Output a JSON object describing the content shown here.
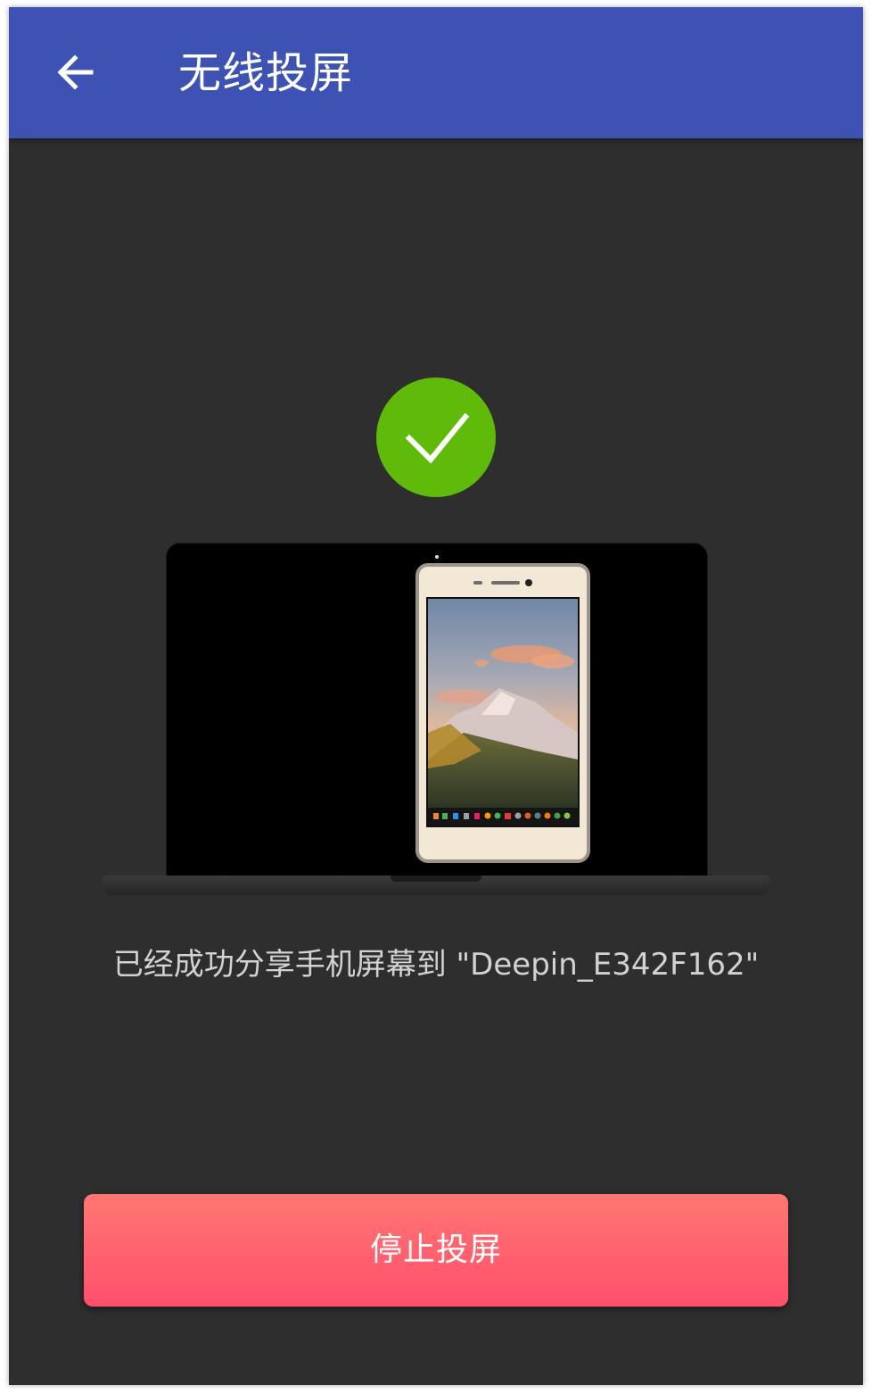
{
  "header": {
    "title": "无线投屏",
    "back_icon": "arrow-left-icon",
    "background_color": "#3e52b4"
  },
  "status": {
    "icon": "checkmark-icon",
    "icon_color": "#5fba0a",
    "message": "已经成功分享手机屏幕到 \"Deepin_E342F162\""
  },
  "illustration": {
    "laptop_icon": "laptop-icon",
    "phone_icon": "phone-icon"
  },
  "actions": {
    "stop_label": "停止投屏",
    "stop_colors": [
      "#ff7772",
      "#ff4f6c"
    ]
  }
}
